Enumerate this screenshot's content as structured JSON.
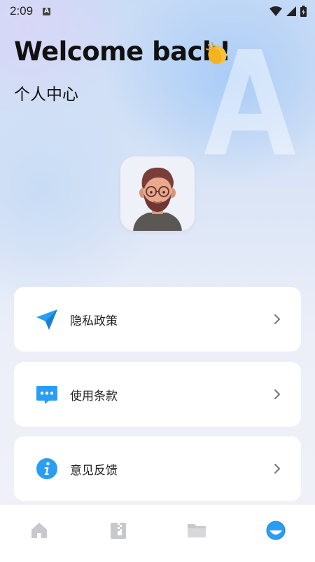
{
  "status_bar": {
    "time": "2:09",
    "notification_icon": "a-badge-icon",
    "icons": [
      "wifi-icon",
      "signal-icon",
      "battery-icon"
    ]
  },
  "header": {
    "welcome": "Welcome back!",
    "welcome_emoji_icon": "clapping-hands-icon",
    "subtitle": "个人中心"
  },
  "profile": {
    "avatar_icon": "user-avatar"
  },
  "menu": {
    "items": [
      {
        "label": "隐私政策",
        "icon": "paper-plane-icon",
        "color": "#2a9df4"
      },
      {
        "label": "使用条款",
        "icon": "chat-bubble-icon",
        "color": "#2a9df4"
      },
      {
        "label": "意见反馈",
        "icon": "info-icon",
        "color": "#2a9df4"
      }
    ]
  },
  "tab_bar": {
    "tabs": [
      {
        "icon": "home-icon",
        "active": false
      },
      {
        "icon": "archive-icon",
        "active": false
      },
      {
        "icon": "folder-icon",
        "active": false
      },
      {
        "icon": "profile-icon",
        "active": true
      }
    ],
    "active_color": "#2a9df4",
    "inactive_color": "#c7c9ce"
  }
}
